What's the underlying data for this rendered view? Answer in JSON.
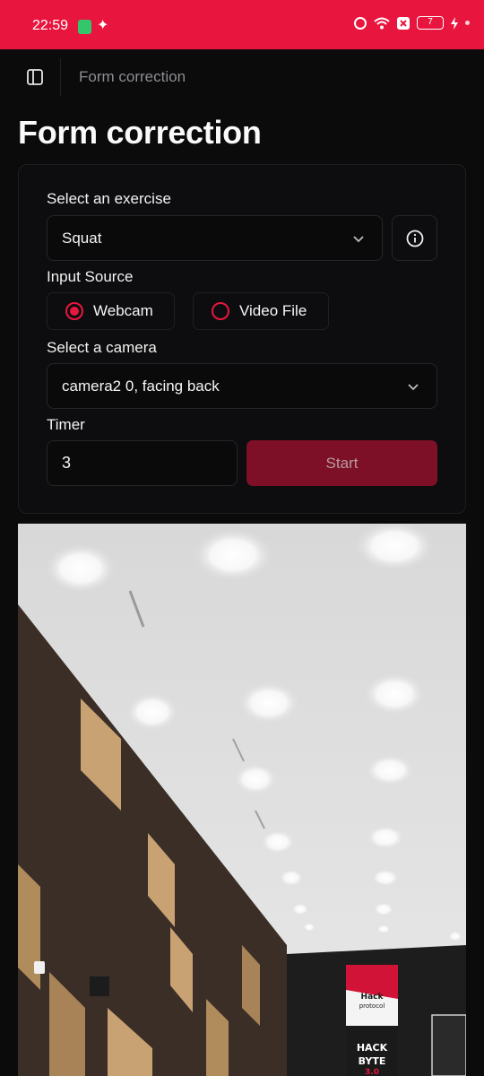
{
  "status_bar": {
    "time": "22:59",
    "battery": "7"
  },
  "appbar": {
    "breadcrumb": "Form correction"
  },
  "page_title": "Form correction",
  "form": {
    "exercise_label": "Select an exercise",
    "exercise_value": "Squat",
    "input_source_label": "Input Source",
    "input_sources": [
      {
        "label": "Webcam",
        "selected": true
      },
      {
        "label": "Video File",
        "selected": false
      }
    ],
    "camera_label": "Select a camera",
    "camera_value": "camera2 0, facing back",
    "timer_label": "Timer",
    "timer_value": "3",
    "start_label": "Start"
  },
  "colors": {
    "accent": "#e8163f",
    "start_button_disabled": "#7d1026",
    "background": "#0b0b0c"
  },
  "icons": [
    "sidebar-toggle-icon",
    "chevron-down-icon",
    "info-icon",
    "alarm-icon",
    "wifi-icon",
    "battery-icon",
    "charging-icon"
  ],
  "banner_text": {
    "line1": "Hack",
    "line2": "protocol",
    "line3": "HACK",
    "line4": "BYTE",
    "line5": "3.0"
  }
}
